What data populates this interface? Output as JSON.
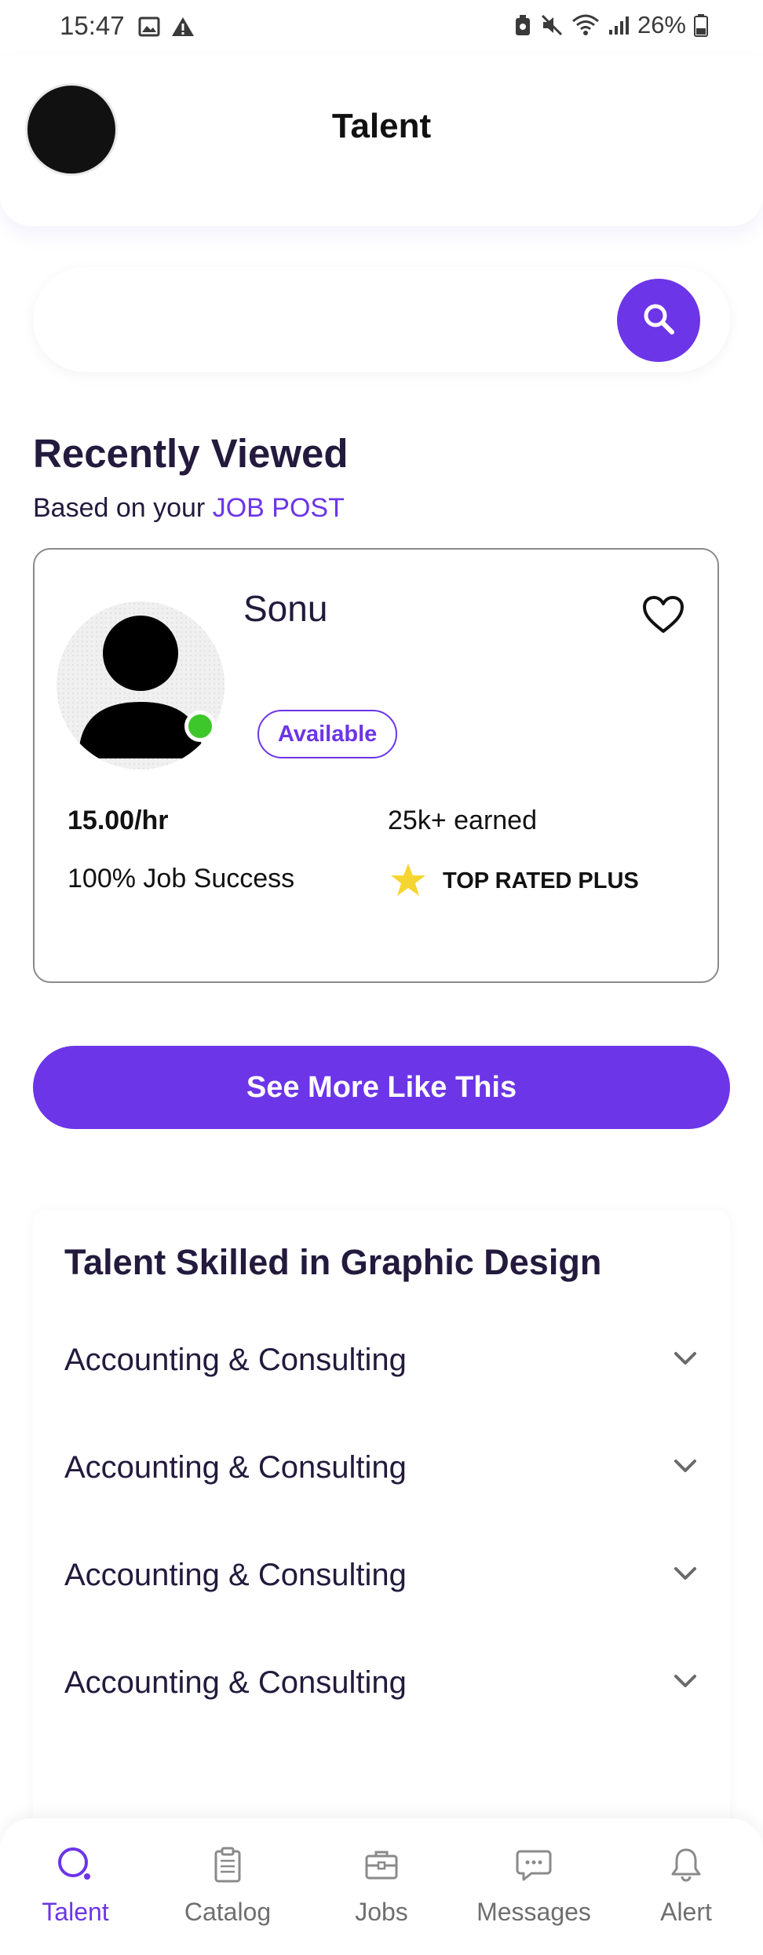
{
  "status_bar": {
    "time": "15:47",
    "battery": "26%"
  },
  "header": {
    "title": "Talent"
  },
  "search": {
    "value": "",
    "placeholder": ""
  },
  "recently_viewed": {
    "title": "Recently Viewed",
    "subtitle_prefix": "Based on your ",
    "subtitle_link": "JOB POST",
    "card": {
      "name": "Sonu",
      "status": "Available",
      "rate": "15.00/hr",
      "earned": "25k+ earned",
      "job_success": "100% Job Success",
      "badge": "TOP RATED PLUS"
    },
    "see_more_label": "See More Like This"
  },
  "skills": {
    "title": "Talent Skilled in Graphic Design",
    "items": [
      {
        "label": "Accounting & Consulting"
      },
      {
        "label": "Accounting & Consulting"
      },
      {
        "label": "Accounting & Consulting"
      },
      {
        "label": "Accounting & Consulting"
      }
    ]
  },
  "nav": {
    "items": [
      {
        "label": "Talent",
        "icon": "search-icon"
      },
      {
        "label": "Catalog",
        "icon": "clipboard-icon"
      },
      {
        "label": "Jobs",
        "icon": "briefcase-icon"
      },
      {
        "label": "Messages",
        "icon": "message-icon"
      },
      {
        "label": "Alert",
        "icon": "bell-icon"
      }
    ],
    "active": "Talent"
  },
  "colors": {
    "accent": "#6c35e8",
    "heading": "#231a3d",
    "online": "#3ec72a",
    "star": "#f7d531"
  }
}
